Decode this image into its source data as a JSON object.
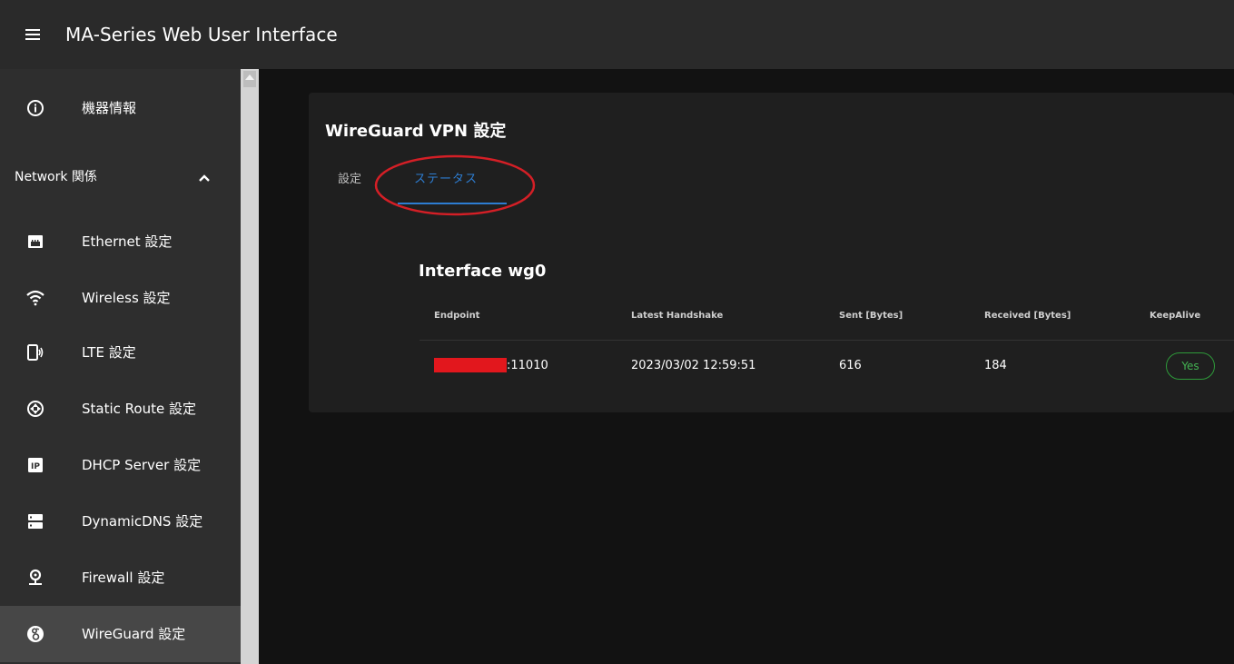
{
  "appbar": {
    "title": "MA-Series Web User Interface",
    "menu_icon": "hamburger-menu-icon"
  },
  "sidebar": {
    "top_item": {
      "label": "機器情報",
      "icon": "info-icon"
    },
    "group": {
      "label": "Network 関係",
      "icon": "chevron-up-icon",
      "expanded": true
    },
    "items": [
      {
        "label": "Ethernet 設定",
        "icon": "ethernet-icon"
      },
      {
        "label": "Wireless 設定",
        "icon": "wifi-icon"
      },
      {
        "label": "LTE 設定",
        "icon": "cellular-icon"
      },
      {
        "label": "Static Route 設定",
        "icon": "route-icon"
      },
      {
        "label": "DHCP Server 設定",
        "icon": "ip-icon"
      },
      {
        "label": "DynamicDNS 設定",
        "icon": "dns-icon"
      },
      {
        "label": "Firewall 設定",
        "icon": "firewall-icon"
      },
      {
        "label": "WireGuard 設定",
        "icon": "wireguard-icon",
        "active": true
      }
    ]
  },
  "main": {
    "title": "WireGuard VPN 設定",
    "tabs": [
      {
        "label": "設定",
        "active": false
      },
      {
        "label": "ステータス",
        "active": true
      }
    ],
    "interface_title": "Interface wg0",
    "table": {
      "headers": [
        "Endpoint",
        "Latest Handshake",
        "Sent [Bytes]",
        "Received [Bytes]",
        "KeepAlive"
      ],
      "rows": [
        {
          "endpoint_port": ":11010",
          "latest_handshake": "2023/03/02 12:59:51",
          "sent": "616",
          "received": "184",
          "keepalive": "Yes"
        }
      ]
    }
  },
  "colors": {
    "accent": "#2d7dd2",
    "badge_green": "#43b052",
    "annotation_red": "#d41f26",
    "redaction_red": "#e2171d"
  }
}
